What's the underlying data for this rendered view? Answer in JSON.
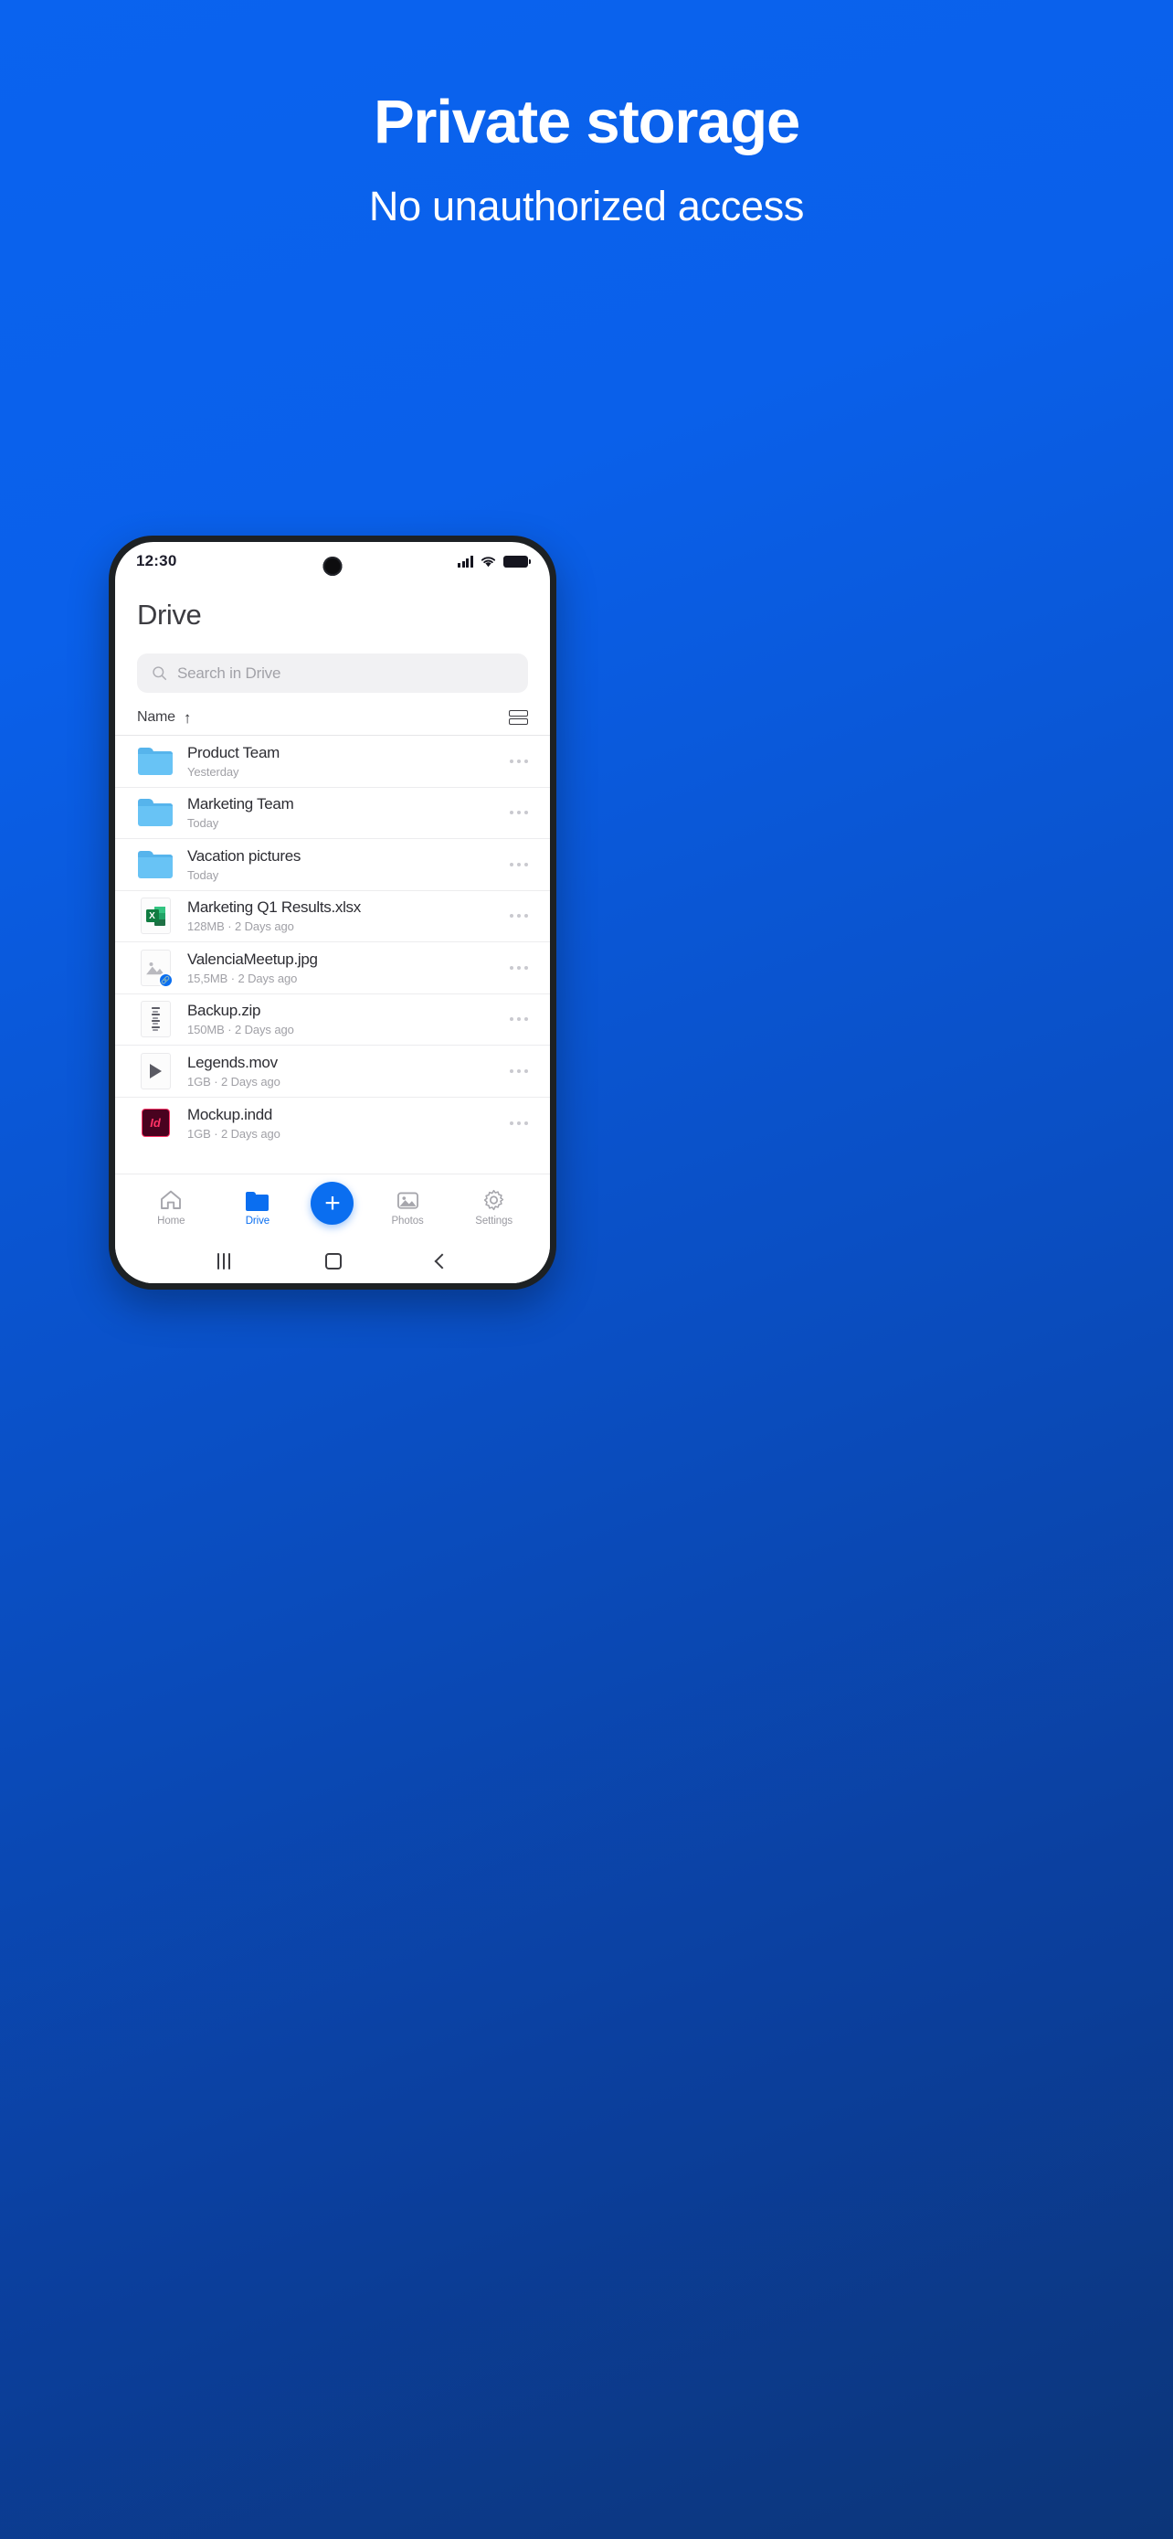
{
  "promo": {
    "title": "Private storage",
    "subtitle": "No unauthorized access"
  },
  "colors": {
    "background_top": "#0a63ef",
    "background_bottom": "#0c3578",
    "accent": "#0a6ef0",
    "folder": "#68c3f5",
    "excel_green": "#107c41",
    "indesign_pink": "#ff3366"
  },
  "statusbar": {
    "time": "12:30",
    "signal_icon": "signal-bars-icon",
    "wifi_icon": "wifi-icon",
    "battery_icon": "battery-full-icon"
  },
  "app": {
    "title": "Drive",
    "search": {
      "placeholder": "Search in Drive",
      "value": "",
      "icon": "search-icon"
    },
    "sortbar": {
      "label": "Name",
      "direction_arrow": "↑",
      "view_toggle_icon": "list-view-icon"
    },
    "files": [
      {
        "name": "Product Team",
        "sub": "Yesterday",
        "icon": "folder-icon",
        "type": "folder",
        "menu": "overflow-menu-icon"
      },
      {
        "name": "Marketing Team",
        "sub": "Today",
        "icon": "folder-icon",
        "type": "folder",
        "menu": "overflow-menu-icon"
      },
      {
        "name": "Vacation pictures",
        "sub": "Today",
        "icon": "folder-icon",
        "type": "folder",
        "menu": "overflow-menu-icon"
      },
      {
        "name": "Marketing Q1 Results.xlsx",
        "sub": "128MB · 2 Days ago",
        "icon": "excel-file-icon",
        "type": "xlsx",
        "menu": "overflow-menu-icon"
      },
      {
        "name": "ValenciaMeetup.jpg",
        "sub": "15,5MB · 2 Days ago",
        "icon": "image-file-icon",
        "type": "jpg",
        "badge": "shared-link-icon",
        "menu": "overflow-menu-icon"
      },
      {
        "name": "Backup.zip",
        "sub": "150MB · 2 Days ago",
        "icon": "zip-file-icon",
        "type": "zip",
        "menu": "overflow-menu-icon"
      },
      {
        "name": "Legends.mov",
        "sub": "1GB · 2 Days ago",
        "icon": "video-file-icon",
        "type": "mov",
        "menu": "overflow-menu-icon"
      },
      {
        "name": "Mockup.indd",
        "sub": "1GB · 2 Days ago",
        "icon": "indesign-file-icon",
        "type": "indd",
        "menu": "overflow-menu-icon"
      }
    ],
    "bottom_nav": {
      "items": [
        {
          "label": "Home",
          "icon": "home-icon",
          "active": false
        },
        {
          "label": "Drive",
          "icon": "folder-icon",
          "active": true
        },
        {
          "label": "Photos",
          "icon": "photos-icon",
          "active": false
        },
        {
          "label": "Settings",
          "icon": "gear-icon",
          "active": false
        }
      ],
      "fab": {
        "label": "+",
        "icon": "plus-icon"
      }
    }
  },
  "system_nav": {
    "recents_icon": "recents-icon",
    "home_icon": "home-square-icon",
    "back_icon": "back-chevron-icon"
  }
}
